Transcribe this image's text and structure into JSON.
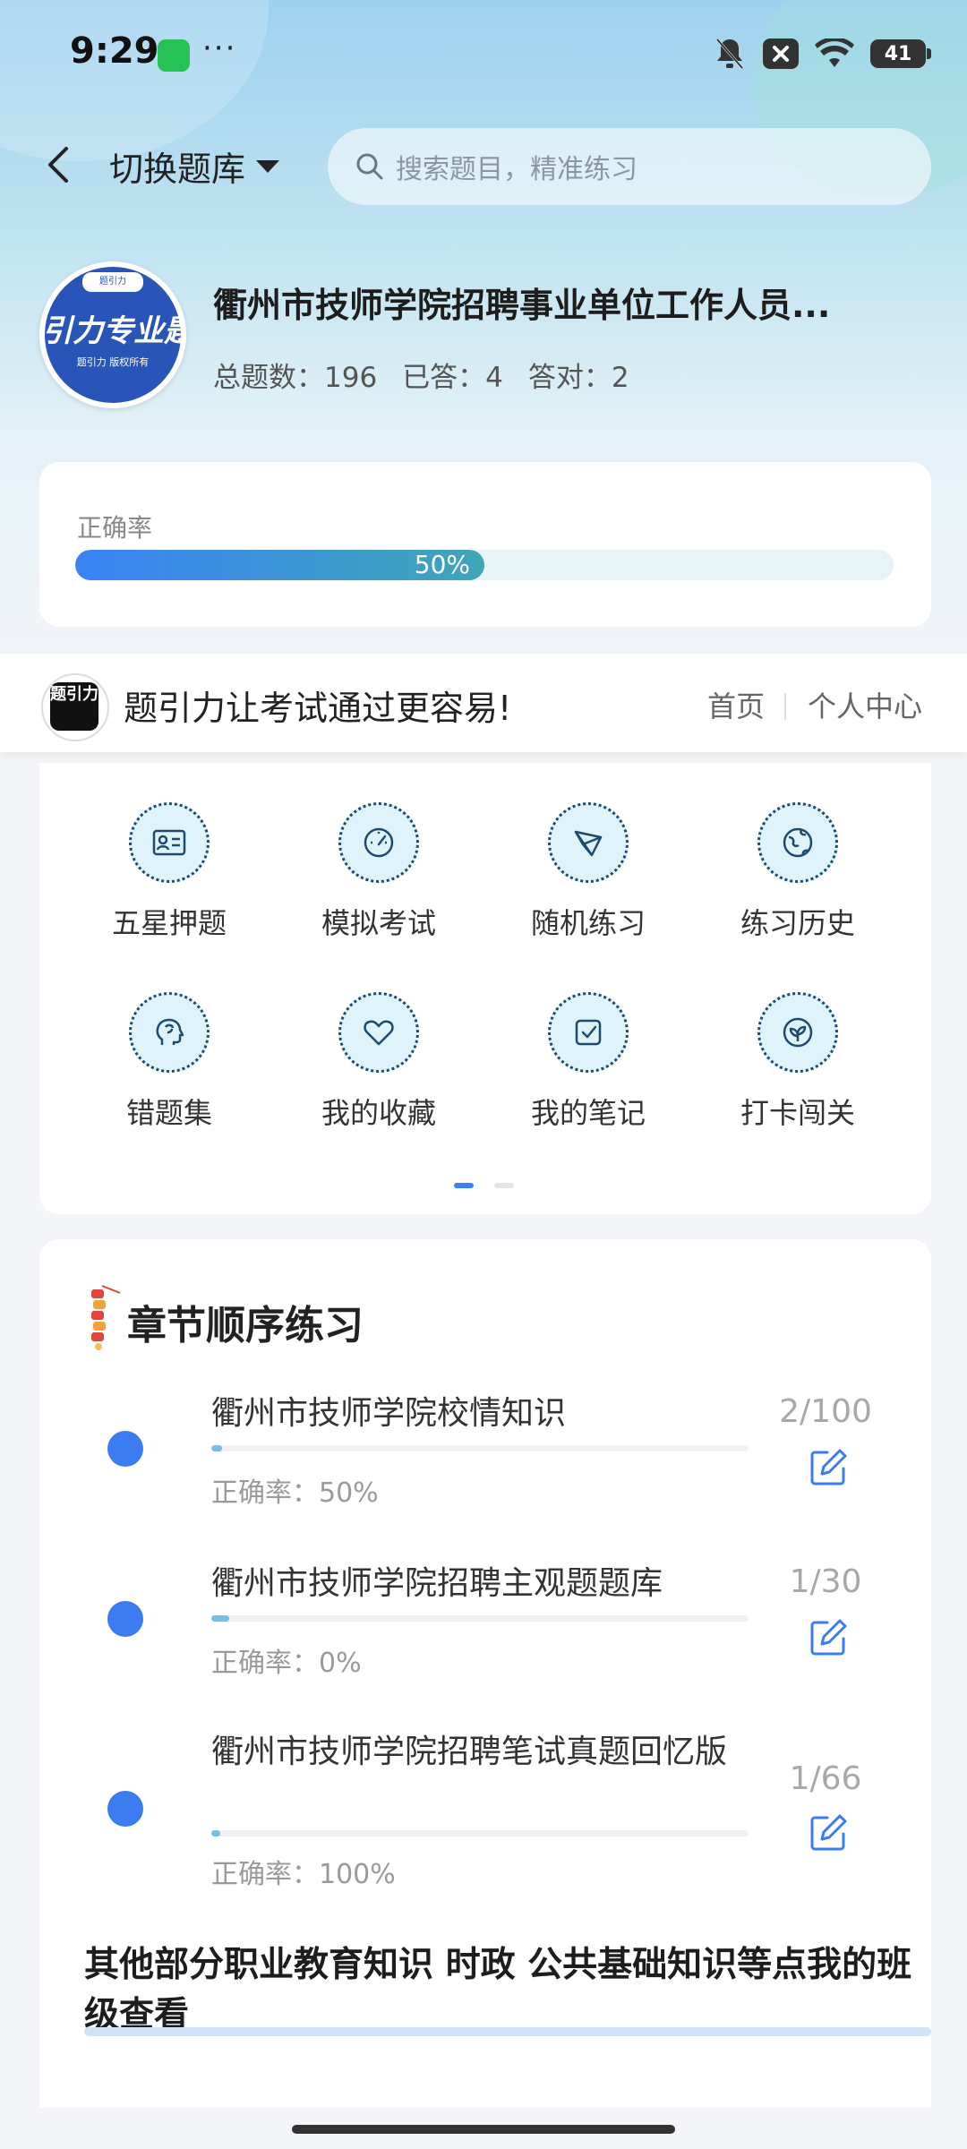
{
  "status": {
    "time": "9:29",
    "battery": "41",
    "more": "···"
  },
  "header": {
    "switch_label": "切换题库",
    "search_placeholder": "搜索题目，精准练习"
  },
  "bank": {
    "logo_text": "引力专业题",
    "logo_sub": "题引力 版权所有",
    "logo_top": "题引力",
    "title": "衢州市技师学院招聘事业单位工作人员...",
    "total_label": "总题数：196",
    "answered_label": "已答：4",
    "correct_label": "答对：2"
  },
  "accuracy": {
    "label": "正确率",
    "percent_text": "50%",
    "value": 0.5
  },
  "promo": {
    "logo_text": "题引力",
    "text": "题引力让考试通过更容易!",
    "home": "首页",
    "user_center": "个人中心"
  },
  "grid": [
    {
      "label": "五星押题",
      "icon": "id-card-icon"
    },
    {
      "label": "模拟考试",
      "icon": "speedometer-icon"
    },
    {
      "label": "随机练习",
      "icon": "shuffle-icon"
    },
    {
      "label": "练习历史",
      "icon": "globe-icon"
    },
    {
      "label": "错题集",
      "icon": "brain-head-icon"
    },
    {
      "label": "我的收藏",
      "icon": "heart-icon"
    },
    {
      "label": "我的笔记",
      "icon": "note-check-icon"
    },
    {
      "label": "打卡闯关",
      "icon": "leaf-badge-icon"
    }
  ],
  "chapters": {
    "title": "章节顺序练习",
    "items": [
      {
        "name": "衢州市技师学院校情知识",
        "count": "2/100",
        "accuracy": "正确率：50%",
        "progress": 0.02
      },
      {
        "name": "衢州市技师学院招聘主观题题库",
        "count": "1/30",
        "accuracy": "正确率：0%",
        "progress": 0.033
      },
      {
        "name": "衢州市技师学院招聘笔试真题回忆版",
        "count": "1/66",
        "accuracy": "正确率：100%",
        "progress": 0.015
      }
    ],
    "footer_text": "其他部分职业教育知识 时政 公共基础知识等点我的班级查看"
  },
  "colors": {
    "accent": "#3b7cf0",
    "progress_fill": "#3fa6b8",
    "icon_stroke": "#1d4a6e",
    "icon_bg": "#dff3fb"
  }
}
